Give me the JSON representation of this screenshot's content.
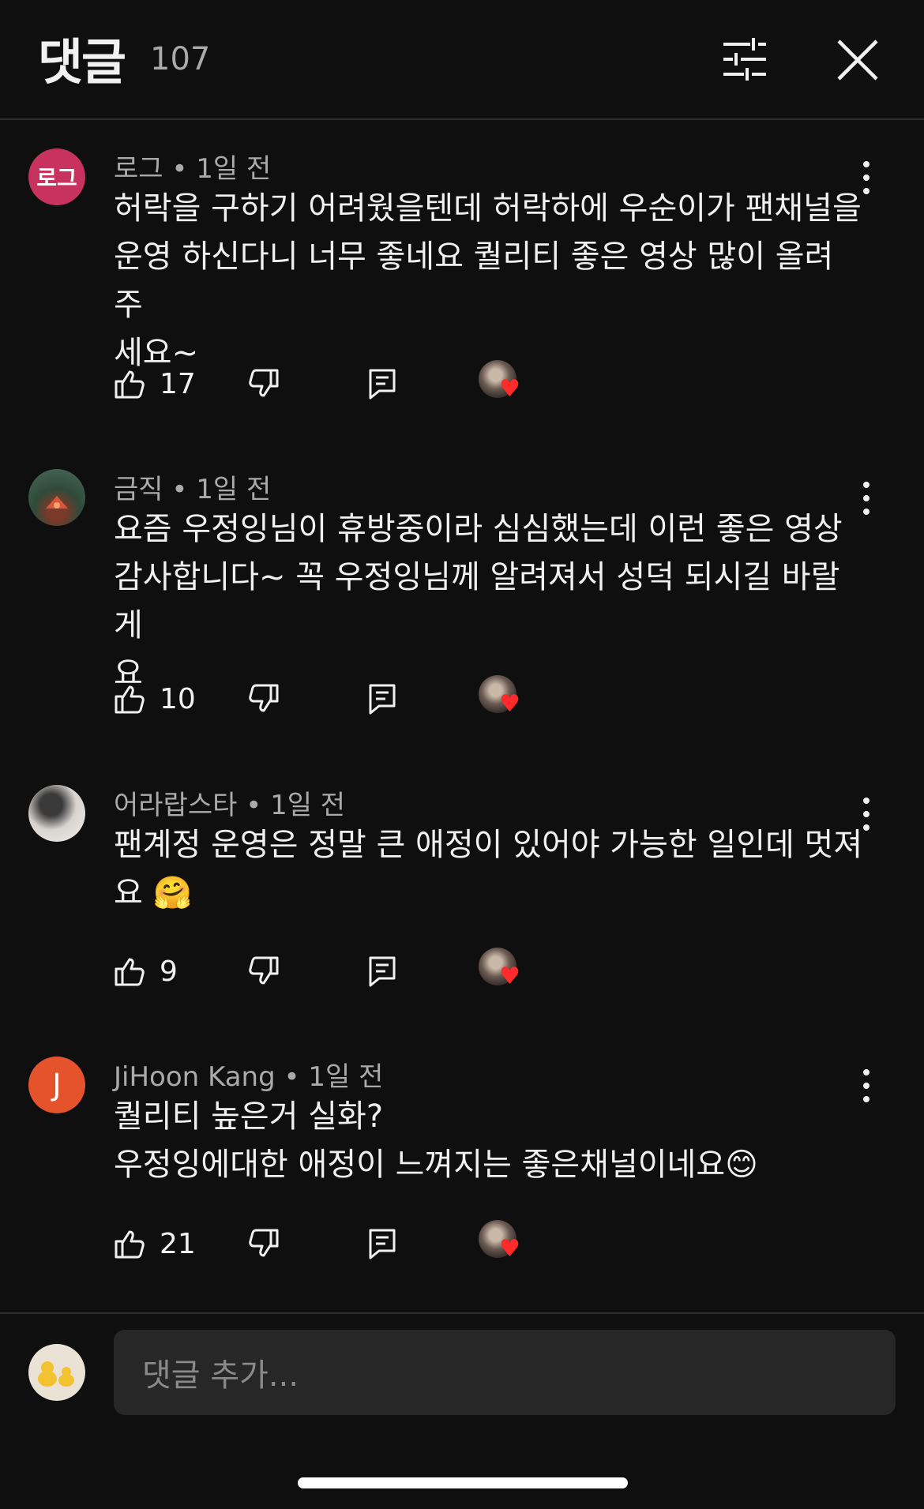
{
  "header": {
    "title": "댓글",
    "count": "107"
  },
  "comments": [
    {
      "avatar_text": "로그",
      "author": "로그",
      "time": "1일 전",
      "lines": [
        "허락을 구하기 어려웠을텐데 허락하에 우순이가 팬채널을",
        "운영 하신다니 너무 좋네요 퀄리티 좋은 영상 많이 올려 주",
        "세요~"
      ],
      "likes": "17"
    },
    {
      "author": "금직",
      "time": "1일 전",
      "lines": [
        "요즘 우정잉님이 휴방중이라 심심했는데 이런 좋은 영상",
        "감사합니다~ 꼭 우정잉님께 알려져서 성덕 되시길 바랄게",
        "요"
      ],
      "likes": "10"
    },
    {
      "author": "어라랍스타",
      "time": "1일 전",
      "lines": [
        "팬계정 운영은 정말 큰 애정이 있어야 가능한 일인데 멋져",
        "요 🤗"
      ],
      "likes": "9"
    },
    {
      "avatar_text": "J",
      "author": "JiHoon Kang",
      "time": "1일 전",
      "lines": [
        "퀄리티 높은거 실화?",
        "우정잉에대한 애정이 느껴지는 좋은채널이네요😊"
      ],
      "likes": "21"
    }
  ],
  "composer": {
    "placeholder": "댓글 추가..."
  },
  "colors": {
    "background": "#0f0f0f",
    "meta_text": "#aaaaaa",
    "heart": "#ff2b2b",
    "avatar_logue": "#c8325e",
    "avatar_j": "#e5532d"
  }
}
